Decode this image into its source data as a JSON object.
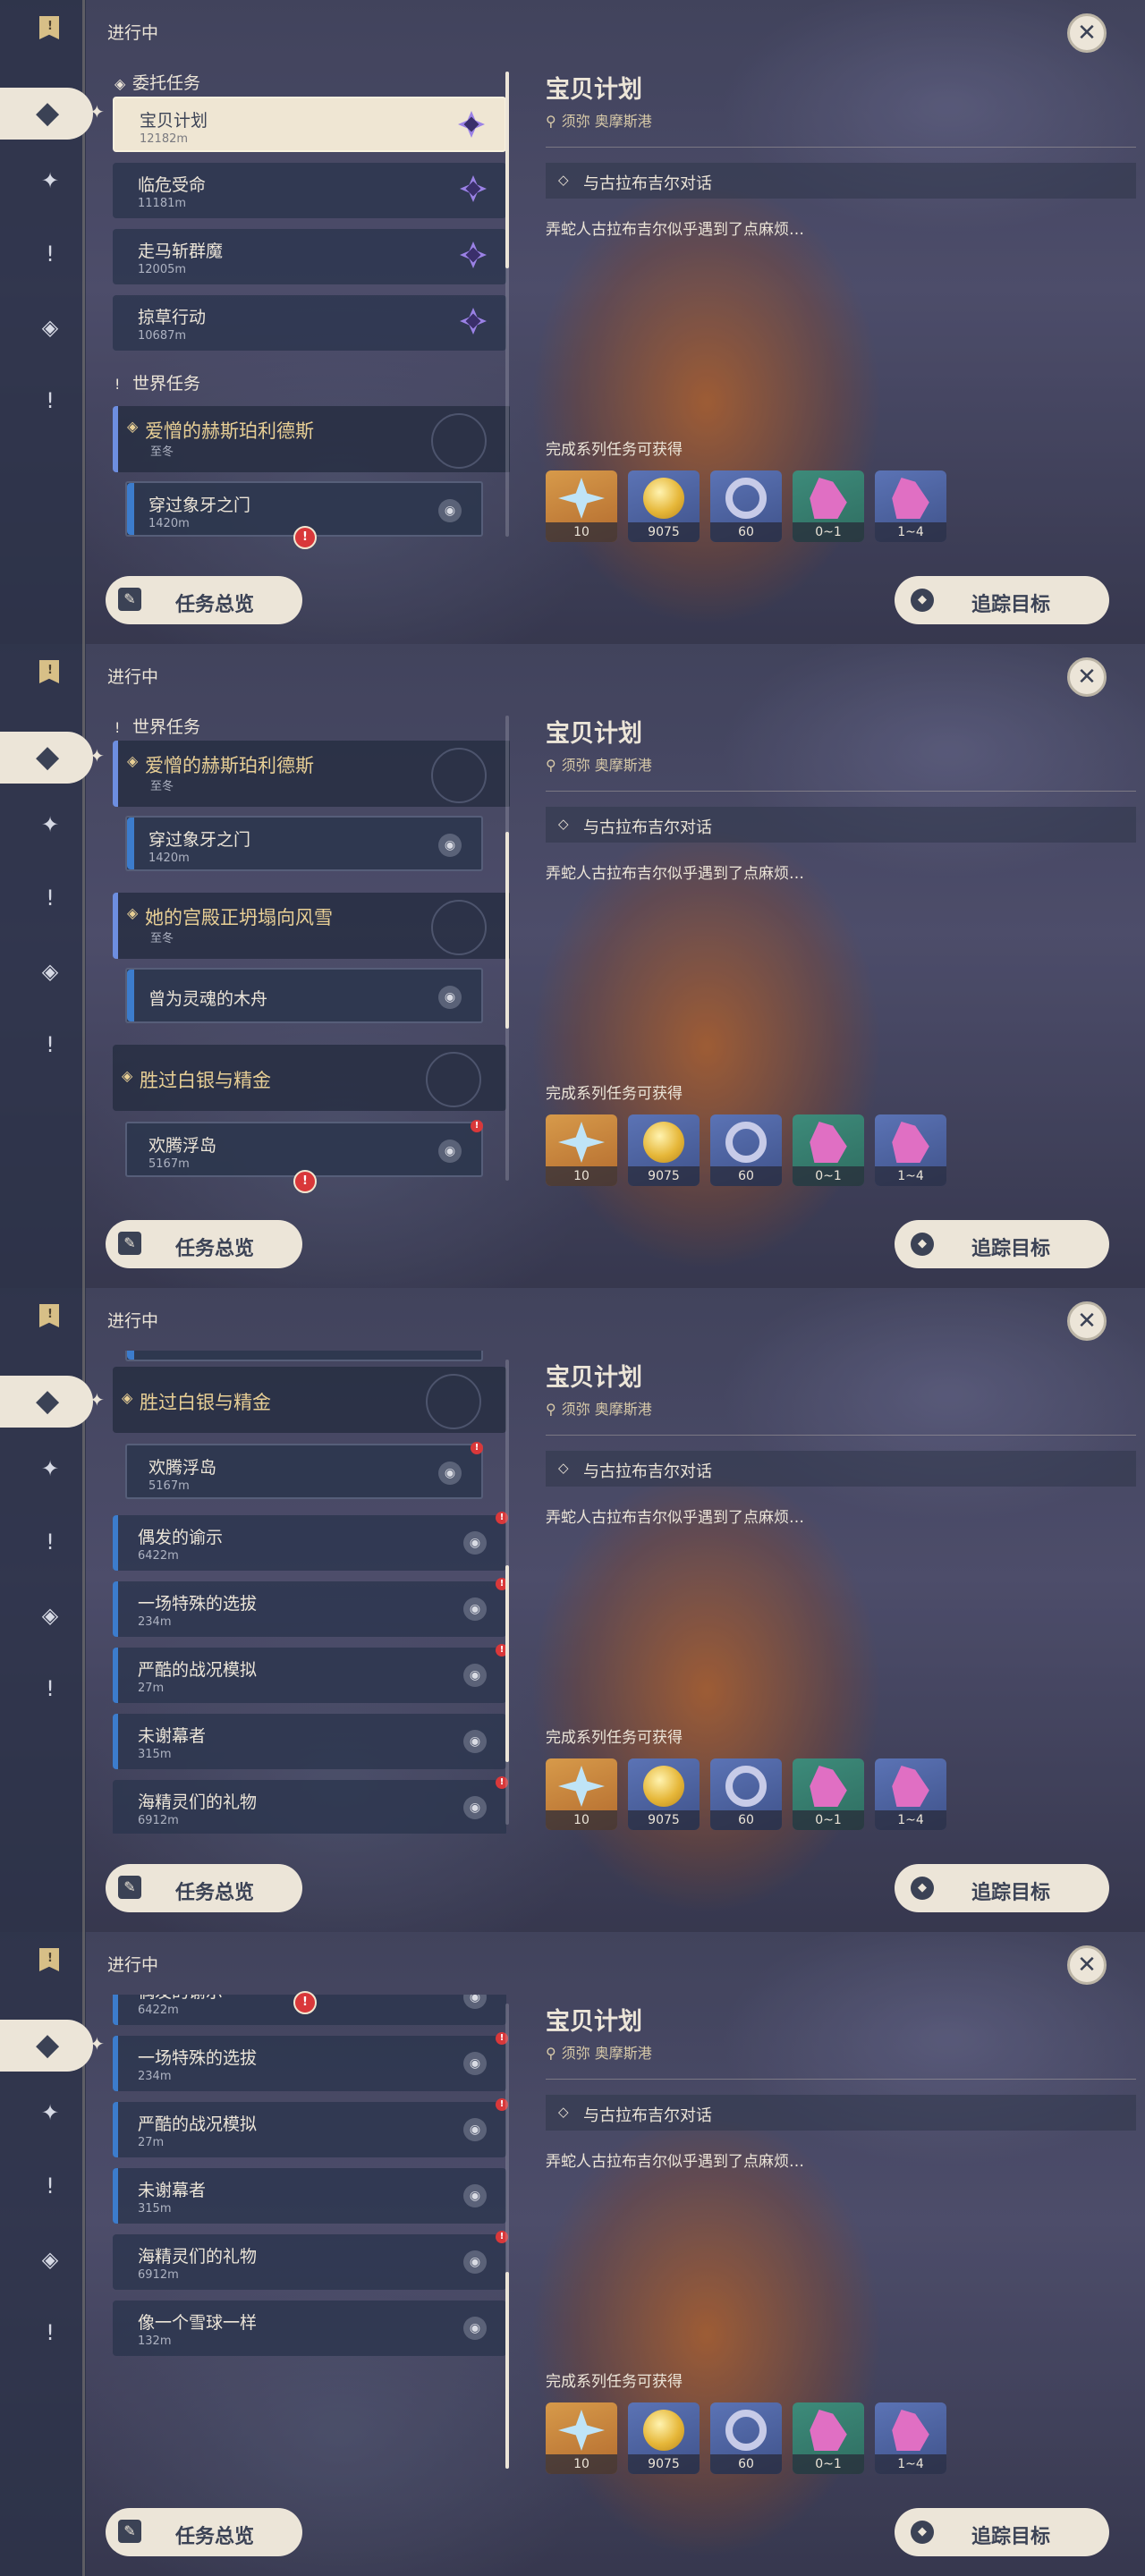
{
  "status_label": "进行中",
  "close_glyph": "✕",
  "sidebar_glyphs": {
    "flag": "!",
    "active": "◆",
    "sparkle": "✦",
    "compass": "✦",
    "alert": "!",
    "diamond": "◈"
  },
  "categories": {
    "commission": "委托任务",
    "world": "世界任务"
  },
  "quests": {
    "baobei": {
      "title": "宝贝计划",
      "dist": "12182m"
    },
    "linwei": {
      "title": "临危受命",
      "dist": "11181m"
    },
    "zouma": {
      "title": "走马斩群魔",
      "dist": "12005m"
    },
    "luecao": {
      "title": "掠草行动",
      "dist": "10687m"
    },
    "aizeng": {
      "title": "爱憎的赫斯珀利德斯",
      "sub": "至冬"
    },
    "xiang": {
      "title": "穿过象牙之门",
      "dist": "1420m"
    },
    "gongdian": {
      "title": "她的宫殿正坍塌向风雪",
      "sub": "至冬"
    },
    "muzhou": {
      "title": "曾为灵魂的木舟"
    },
    "baiyin": {
      "title": "胜过白银与精金"
    },
    "huanteng": {
      "title": "欢腾浮岛",
      "dist": "5167m"
    },
    "oufa": {
      "title": "偶发的谕示",
      "dist": "6422m"
    },
    "teshu": {
      "title": "一场特殊的选拔",
      "dist": "234m"
    },
    "yanku": {
      "title": "严酷的战况模拟",
      "dist": "27m"
    },
    "muxie": {
      "title": "未谢幕者",
      "dist": "315m"
    },
    "haijing": {
      "title": "海精灵们的礼物",
      "dist": "6912m"
    },
    "xueqiu": {
      "title": "像一个雪球一样",
      "dist": "132m"
    }
  },
  "buttons": {
    "overview": "任务总览",
    "track": "追踪目标",
    "overview_icon": "✎",
    "track_icon": "◆"
  },
  "detail": {
    "title": "宝贝计划",
    "location": "须弥 奥摩斯港",
    "objective": "与古拉布吉尔对话",
    "description": "弄蛇人古拉布吉尔似乎遇到了点麻烦…",
    "rewards_title": "完成系列任务可获得",
    "rewards": [
      {
        "icon": "primogem-icon",
        "count": "10"
      },
      {
        "icon": "mora-icon",
        "count": "9075"
      },
      {
        "icon": "fellowship-ring-icon",
        "count": "60"
      },
      {
        "icon": "crystal-icon",
        "count": "0~1"
      },
      {
        "icon": "crystal-cluster-icon",
        "count": "1~4"
      }
    ]
  },
  "colors": {
    "cream": "#ece5d8",
    "gold_text": "#e8cf95",
    "accent_blue": "#3c7ccc",
    "alert_red": "#d9383a"
  }
}
